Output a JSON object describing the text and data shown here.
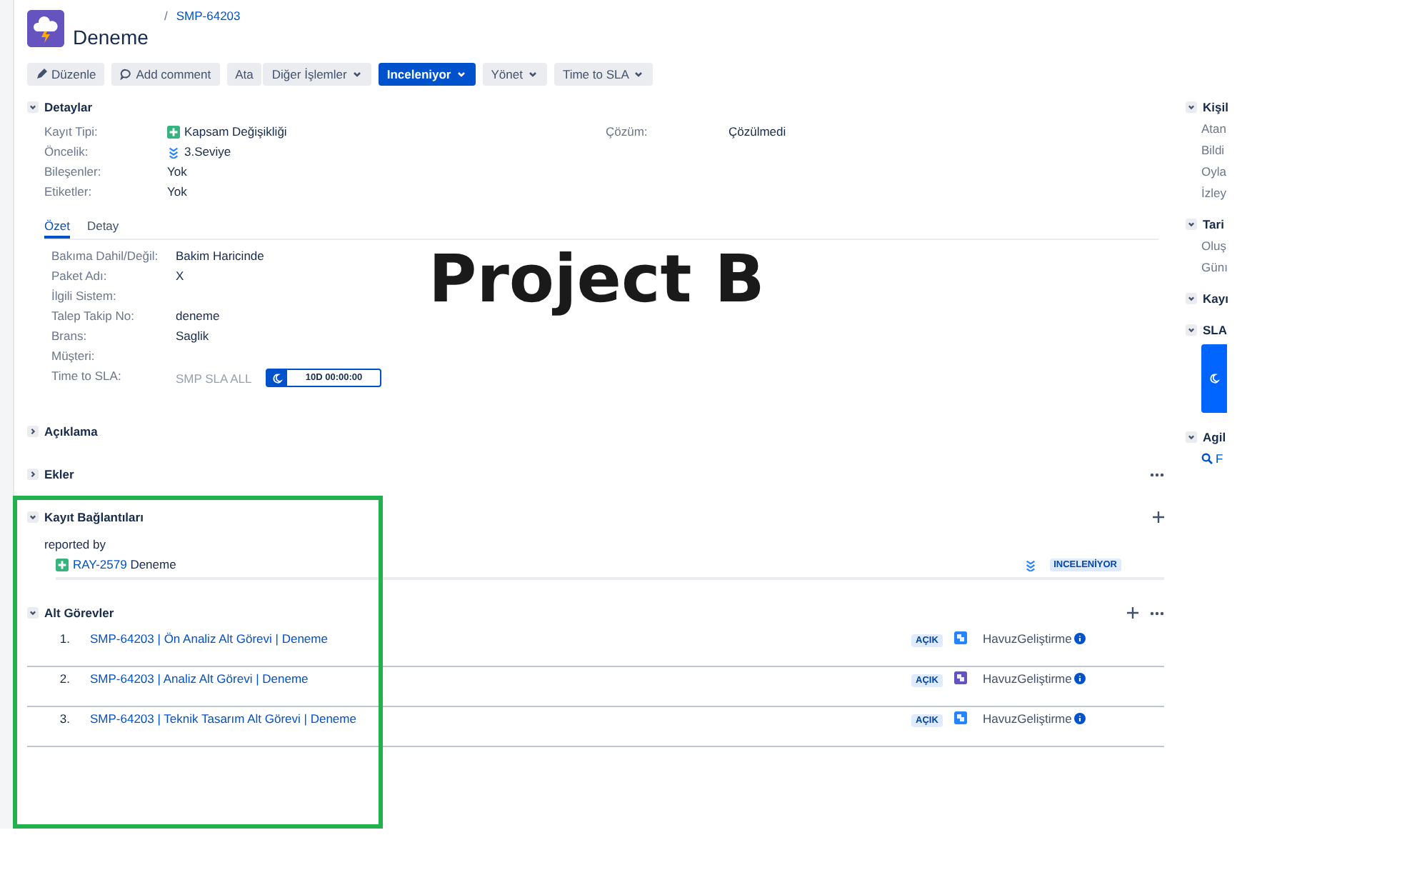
{
  "header": {
    "separator": "/",
    "issue_key": "SMP-64203",
    "title": "Deneme"
  },
  "toolbar": [
    {
      "label": "Düzenle",
      "kind": "edit"
    },
    {
      "label": "Add comment",
      "kind": "comment"
    },
    {
      "label": "Ata",
      "kind": "action"
    },
    {
      "label": "Diğer İşlemler",
      "kind": "menu"
    },
    {
      "label": "Inceleniyor",
      "kind": "status"
    },
    {
      "label": "Yönet",
      "kind": "menu"
    },
    {
      "label": "Time to SLA",
      "kind": "menu"
    }
  ],
  "details": {
    "title": "Detaylar",
    "expanded": true,
    "left_fields": [
      {
        "label": "Kayıt Tipi:",
        "value": "Kapsam Değişikliği",
        "kind": "issue_type"
      },
      {
        "label": "Öncelik:",
        "value": "3.Seviye",
        "kind": "priority"
      },
      {
        "label": "Bileşenler:",
        "value": "Yok",
        "kind": "text"
      },
      {
        "label": "Etiketler:",
        "value": "Yok",
        "kind": "text"
      }
    ],
    "right_fields": [
      {
        "label": "Çözüm:",
        "value": "Çözülmedi"
      }
    ]
  },
  "tabs": [
    {
      "label": "Özet",
      "selected": true
    },
    {
      "label": "Detay",
      "selected": false
    }
  ],
  "summary_fields": [
    {
      "label": "Bakıma Dahil/Değil:",
      "value": "Bakim Haricinde",
      "kind": "text"
    },
    {
      "label": "Paket Adı:",
      "value": "X",
      "kind": "text"
    },
    {
      "label": "İlgili Sistem:",
      "kind": "redacted"
    },
    {
      "label": "Talep Takip No:",
      "value": "deneme",
      "kind": "text"
    },
    {
      "label": "Brans:",
      "value": "Saglik",
      "kind": "text"
    },
    {
      "label": "Müşteri:",
      "kind": "redacted"
    },
    {
      "label": "Time to SLA:",
      "value": "SMP SLA ALL",
      "timer": "10D 00:00:00",
      "kind": "sla"
    }
  ],
  "collapsed_sections": [
    {
      "title": "Açıklama",
      "expanded": false,
      "more_menu": false
    },
    {
      "title": "Ekler",
      "expanded": false,
      "more_menu": true
    }
  ],
  "links": {
    "title": "Kayıt Bağlantıları",
    "expanded": true,
    "relation": "reported by",
    "items": [
      {
        "key": "RAY-2579",
        "summary": "Deneme",
        "status": "INCELENİYOR"
      }
    ]
  },
  "subtasks": {
    "title": "Alt Görevler",
    "expanded": true,
    "items": [
      {
        "number": "1.",
        "summary": "SMP-64203 | Ön Analiz Alt Görevi | Deneme",
        "status": "AÇIK",
        "color": "#2684ff",
        "team": "HavuzGeliştirme"
      },
      {
        "number": "2.",
        "summary": "SMP-64203 | Analiz Alt Görevi | Deneme",
        "status": "AÇIK",
        "color": "#6554c0",
        "team": "HavuzGeliştirme"
      },
      {
        "number": "3.",
        "summary": "SMP-64203 | Teknik Tasarım Alt Görevi | Deneme",
        "status": "AÇIK",
        "color": "#2684ff",
        "team": "HavuzGeliştirme"
      }
    ]
  },
  "side_panel": [
    {
      "title": "Kişil",
      "expanded": true,
      "kind": "fields",
      "fields": [
        "Atan",
        "Bildi",
        "Oyla",
        "İzley"
      ]
    },
    {
      "title": "Tari",
      "expanded": true,
      "kind": "fields",
      "fields": [
        "Oluş",
        "Günı"
      ]
    },
    {
      "title": "Kayı",
      "expanded": true,
      "kind": "fields"
    },
    {
      "title": "SLA",
      "expanded": true,
      "kind": "sla"
    },
    {
      "title": "Agil",
      "expanded": true,
      "kind": "search",
      "fields": [
        "F"
      ]
    }
  ],
  "overlay_label": "Project B"
}
